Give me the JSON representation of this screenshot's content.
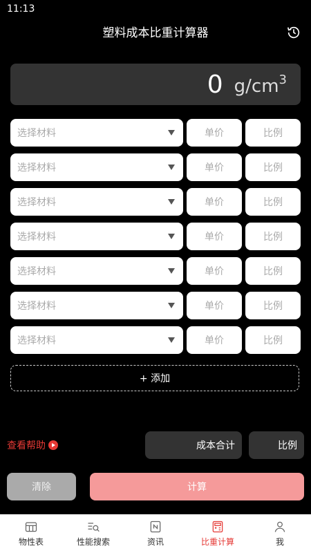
{
  "status_bar": {
    "time": "11:13"
  },
  "header": {
    "title": "塑料成本比重计算器"
  },
  "result": {
    "value": "0",
    "unit": "g/cm",
    "unit_exp": "3"
  },
  "rows": [
    {
      "material_placeholder": "选择材料",
      "price_placeholder": "单价",
      "ratio_placeholder": "比例"
    },
    {
      "material_placeholder": "选择材料",
      "price_placeholder": "单价",
      "ratio_placeholder": "比例"
    },
    {
      "material_placeholder": "选择材料",
      "price_placeholder": "单价",
      "ratio_placeholder": "比例"
    },
    {
      "material_placeholder": "选择材料",
      "price_placeholder": "单价",
      "ratio_placeholder": "比例"
    },
    {
      "material_placeholder": "选择材料",
      "price_placeholder": "单价",
      "ratio_placeholder": "比例"
    },
    {
      "material_placeholder": "选择材料",
      "price_placeholder": "单价",
      "ratio_placeholder": "比例"
    },
    {
      "material_placeholder": "选择材料",
      "price_placeholder": "单价",
      "ratio_placeholder": "比例"
    }
  ],
  "add_label": "+ 添加",
  "help_label": "查看帮助",
  "totals": {
    "cost_label": "成本合计",
    "ratio_label": "比例"
  },
  "actions": {
    "clear_label": "清除",
    "calculate_label": "计算"
  },
  "tabs": [
    {
      "label": "物性表",
      "icon": "table-icon"
    },
    {
      "label": "性能搜索",
      "icon": "search-list-icon"
    },
    {
      "label": "资讯",
      "icon": "news-icon"
    },
    {
      "label": "比重计算",
      "icon": "calculator-icon",
      "active": true
    },
    {
      "label": "我",
      "icon": "user-icon"
    }
  ],
  "colors": {
    "accent": "#e53935",
    "calc_button": "#f59a9a",
    "clear_button": "#aaaaaa",
    "panel": "#333333"
  }
}
